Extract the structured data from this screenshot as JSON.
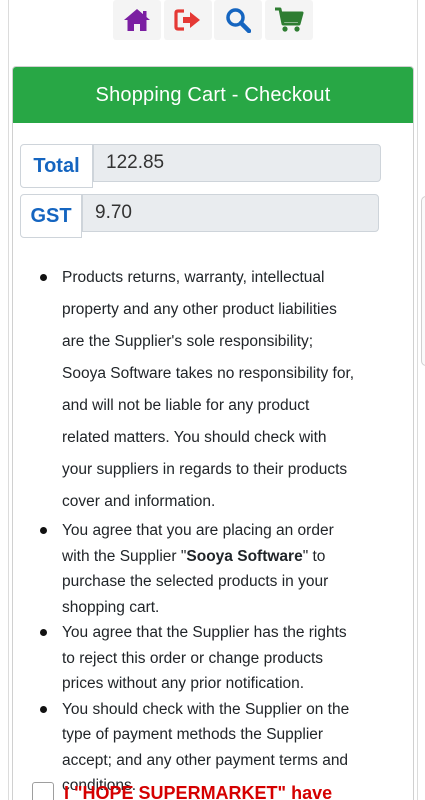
{
  "nav": {
    "icons": [
      "home-icon",
      "logout-icon",
      "search-icon",
      "cart-icon"
    ],
    "colors": {
      "home": "#7b1fa2",
      "logout": "#e53935",
      "search": "#1565c0",
      "cart": "#2e7d32"
    }
  },
  "checkout": {
    "header": "Shopping Cart - Checkout",
    "header_color": "#28a745",
    "total_label": "Total",
    "total_value": "122.85",
    "gst_label": "GST",
    "gst_value": "9.70"
  },
  "terms": [
    {
      "text": "Products returns, warranty, intellectual property and any other product liabilities are the Supplier's sole responsibility; Sooya Software takes no responsibility for, and will not be liable for any product related matters. You should check with your suppliers in regards to their products cover and information."
    },
    {
      "before": "You agree that you are placing an order with the Supplier \"",
      "bold": "Sooya Software",
      "after": "\" to purchase the selected products in your shopping cart."
    },
    {
      "text": "You agree that the Supplier has the rights to reject this order or change products prices without any prior notification."
    },
    {
      "text": "You should check with the Supplier on the type of payment methods the Supplier accept; and any other payment terms and conditions."
    }
  ],
  "agreement": {
    "text": "I \"HOPE SUPERMARKET\" have",
    "color": "#d50000"
  }
}
